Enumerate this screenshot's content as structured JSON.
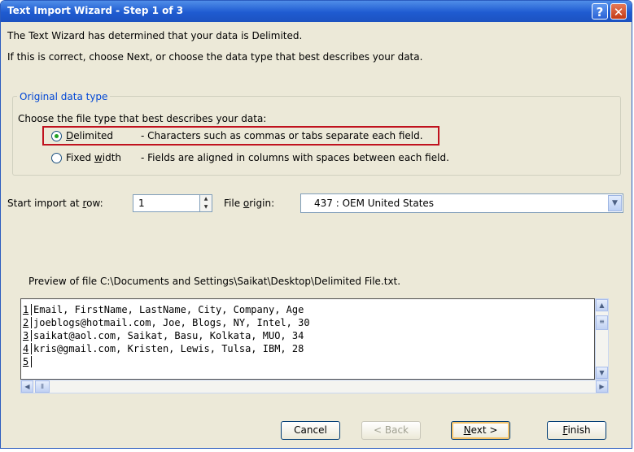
{
  "window": {
    "title": "Text Import Wizard - Step 1 of 3",
    "help_label": "?",
    "close_label": "✕",
    "accent_color": "#1f5bd1"
  },
  "intro": {
    "line1": "The Text Wizard has determined that your data is Delimited.",
    "line2": "If this is correct, choose Next, or choose the data type that best describes your data."
  },
  "original_data_type": {
    "legend": "Original data type",
    "prompt": "Choose the file type that best describes your data:",
    "options": [
      {
        "label": "Delimited",
        "mnemonic": "D",
        "rest": "elimited",
        "description": "- Characters such as commas or tabs separate each field.",
        "checked": true
      },
      {
        "label": "Fixed width",
        "pre": "Fixed ",
        "mnemonic": "w",
        "rest": "idth",
        "description": "- Fields are aligned in columns with spaces between each field.",
        "checked": false
      }
    ],
    "highlight_color": "#c0121e"
  },
  "start_row": {
    "label_pre": "Start import at ",
    "mnemonic": "r",
    "label_post": "ow:",
    "value": "1"
  },
  "file_origin": {
    "mnemonic": "o",
    "label_pre": "File ",
    "label_post": "rigin:",
    "value": "437 : OEM United States"
  },
  "preview": {
    "label": "Preview of file C:\\Documents and Settings\\Saikat\\Desktop\\Delimited File.txt.",
    "rows": [
      {
        "num": "1",
        "text": "Email, FirstName, LastName, City, Company, Age"
      },
      {
        "num": "2",
        "text": "joeblogs@hotmail.com, Joe, Blogs, NY, Intel, 30"
      },
      {
        "num": "3",
        "text": "saikat@aol.com, Saikat, Basu, Kolkata, MUO, 34"
      },
      {
        "num": "4",
        "text": "kris@gmail.com, Kristen, Lewis, Tulsa, IBM, 28"
      },
      {
        "num": "5",
        "text": ""
      }
    ]
  },
  "buttons": {
    "cancel": "Cancel",
    "back": "< Back",
    "next_mnemonic": "N",
    "next_rest": "ext >",
    "finish_mnemonic": "F",
    "finish_rest": "inish"
  }
}
